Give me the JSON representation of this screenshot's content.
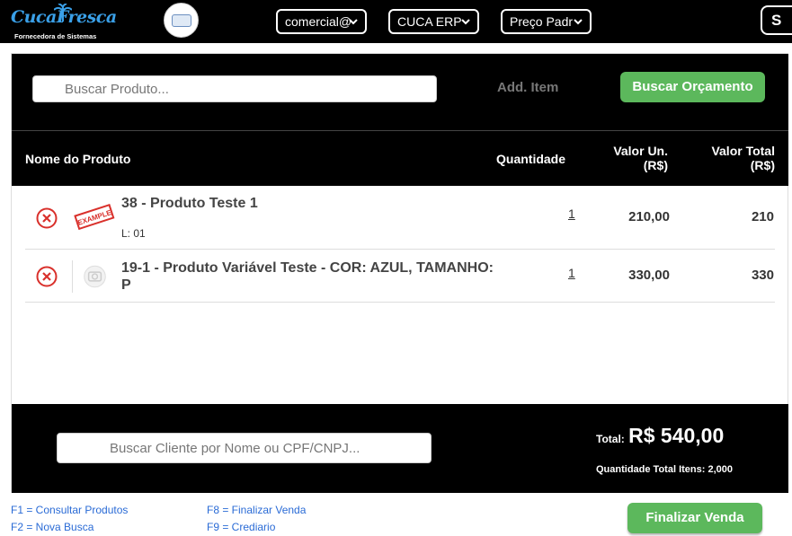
{
  "brand": {
    "logo_text": "CucaFresca",
    "logo_tagline": "Fornecedora de Sistemas",
    "logo_icon": "palm-tree-icon",
    "badge_icon": "company-seal-icon"
  },
  "topbar": {
    "user_select": "comercial@",
    "company_select": "CUCA ERP",
    "price_select": "Preço Padr",
    "right_button": "S"
  },
  "search": {
    "placeholder": "Buscar Produto...",
    "add_item": "Add. Item",
    "budget_button": "Buscar Orçamento"
  },
  "table": {
    "headers": {
      "name": "Nome do Produto",
      "quantity": "Quantidade",
      "unit_value_line1": "Valor Un.",
      "unit_value_line2": "(R$)",
      "total_value_line1": "Valor Total",
      "total_value_line2": "(R$)"
    },
    "rows": [
      {
        "name": "38 - Produto Teste 1",
        "lot": "L: 01",
        "image": "example-stamp",
        "quantity": "1",
        "unit_value": "210,00",
        "total_value": "210"
      },
      {
        "name": "19-1 - Produto Variável Teste - COR: AZUL, TAMANHO: P",
        "image": "no-image-camera",
        "quantity": "1",
        "unit_value": "330,00",
        "total_value": "330"
      }
    ]
  },
  "footer": {
    "client_placeholder": "Buscar Cliente por Nome ou CPF/CNPJ...",
    "total_label": "Total:",
    "total_value": "R$ 540,00",
    "qty_total": "Quantidade Total Itens: 2,000"
  },
  "shortcuts": {
    "f1": "F1 = Consultar Produtos",
    "f2": "F2 = Nova Busca",
    "f8": "F8 = Finalizar Venda",
    "f9": "F9 = Crediario"
  },
  "finalize_button": "Finalizar Venda",
  "colors": {
    "accent_green": "#5cb85c",
    "remove_red": "#d9302b",
    "link_blue": "#2a6bd6",
    "bar_black": "#000000"
  }
}
